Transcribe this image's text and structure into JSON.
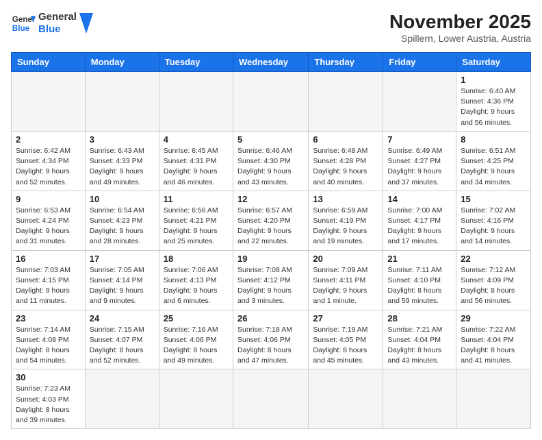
{
  "header": {
    "logo_general": "General",
    "logo_blue": "Blue",
    "month_title": "November 2025",
    "subtitle": "Spillern, Lower Austria, Austria"
  },
  "weekdays": [
    "Sunday",
    "Monday",
    "Tuesday",
    "Wednesday",
    "Thursday",
    "Friday",
    "Saturday"
  ],
  "weeks": [
    [
      {
        "day": "",
        "info": ""
      },
      {
        "day": "",
        "info": ""
      },
      {
        "day": "",
        "info": ""
      },
      {
        "day": "",
        "info": ""
      },
      {
        "day": "",
        "info": ""
      },
      {
        "day": "",
        "info": ""
      },
      {
        "day": "1",
        "info": "Sunrise: 6:40 AM\nSunset: 4:36 PM\nDaylight: 9 hours and 56 minutes."
      }
    ],
    [
      {
        "day": "2",
        "info": "Sunrise: 6:42 AM\nSunset: 4:34 PM\nDaylight: 9 hours and 52 minutes."
      },
      {
        "day": "3",
        "info": "Sunrise: 6:43 AM\nSunset: 4:33 PM\nDaylight: 9 hours and 49 minutes."
      },
      {
        "day": "4",
        "info": "Sunrise: 6:45 AM\nSunset: 4:31 PM\nDaylight: 9 hours and 46 minutes."
      },
      {
        "day": "5",
        "info": "Sunrise: 6:46 AM\nSunset: 4:30 PM\nDaylight: 9 hours and 43 minutes."
      },
      {
        "day": "6",
        "info": "Sunrise: 6:48 AM\nSunset: 4:28 PM\nDaylight: 9 hours and 40 minutes."
      },
      {
        "day": "7",
        "info": "Sunrise: 6:49 AM\nSunset: 4:27 PM\nDaylight: 9 hours and 37 minutes."
      },
      {
        "day": "8",
        "info": "Sunrise: 6:51 AM\nSunset: 4:25 PM\nDaylight: 9 hours and 34 minutes."
      }
    ],
    [
      {
        "day": "9",
        "info": "Sunrise: 6:53 AM\nSunset: 4:24 PM\nDaylight: 9 hours and 31 minutes."
      },
      {
        "day": "10",
        "info": "Sunrise: 6:54 AM\nSunset: 4:23 PM\nDaylight: 9 hours and 28 minutes."
      },
      {
        "day": "11",
        "info": "Sunrise: 6:56 AM\nSunset: 4:21 PM\nDaylight: 9 hours and 25 minutes."
      },
      {
        "day": "12",
        "info": "Sunrise: 6:57 AM\nSunset: 4:20 PM\nDaylight: 9 hours and 22 minutes."
      },
      {
        "day": "13",
        "info": "Sunrise: 6:59 AM\nSunset: 4:19 PM\nDaylight: 9 hours and 19 minutes."
      },
      {
        "day": "14",
        "info": "Sunrise: 7:00 AM\nSunset: 4:17 PM\nDaylight: 9 hours and 17 minutes."
      },
      {
        "day": "15",
        "info": "Sunrise: 7:02 AM\nSunset: 4:16 PM\nDaylight: 9 hours and 14 minutes."
      }
    ],
    [
      {
        "day": "16",
        "info": "Sunrise: 7:03 AM\nSunset: 4:15 PM\nDaylight: 9 hours and 11 minutes."
      },
      {
        "day": "17",
        "info": "Sunrise: 7:05 AM\nSunset: 4:14 PM\nDaylight: 9 hours and 9 minutes."
      },
      {
        "day": "18",
        "info": "Sunrise: 7:06 AM\nSunset: 4:13 PM\nDaylight: 9 hours and 6 minutes."
      },
      {
        "day": "19",
        "info": "Sunrise: 7:08 AM\nSunset: 4:12 PM\nDaylight: 9 hours and 3 minutes."
      },
      {
        "day": "20",
        "info": "Sunrise: 7:09 AM\nSunset: 4:11 PM\nDaylight: 9 hours and 1 minute."
      },
      {
        "day": "21",
        "info": "Sunrise: 7:11 AM\nSunset: 4:10 PM\nDaylight: 8 hours and 59 minutes."
      },
      {
        "day": "22",
        "info": "Sunrise: 7:12 AM\nSunset: 4:09 PM\nDaylight: 8 hours and 56 minutes."
      }
    ],
    [
      {
        "day": "23",
        "info": "Sunrise: 7:14 AM\nSunset: 4:08 PM\nDaylight: 8 hours and 54 minutes."
      },
      {
        "day": "24",
        "info": "Sunrise: 7:15 AM\nSunset: 4:07 PM\nDaylight: 8 hours and 52 minutes."
      },
      {
        "day": "25",
        "info": "Sunrise: 7:16 AM\nSunset: 4:06 PM\nDaylight: 8 hours and 49 minutes."
      },
      {
        "day": "26",
        "info": "Sunrise: 7:18 AM\nSunset: 4:06 PM\nDaylight: 8 hours and 47 minutes."
      },
      {
        "day": "27",
        "info": "Sunrise: 7:19 AM\nSunset: 4:05 PM\nDaylight: 8 hours and 45 minutes."
      },
      {
        "day": "28",
        "info": "Sunrise: 7:21 AM\nSunset: 4:04 PM\nDaylight: 8 hours and 43 minutes."
      },
      {
        "day": "29",
        "info": "Sunrise: 7:22 AM\nSunset: 4:04 PM\nDaylight: 8 hours and 41 minutes."
      }
    ],
    [
      {
        "day": "30",
        "info": "Sunrise: 7:23 AM\nSunset: 4:03 PM\nDaylight: 8 hours and 39 minutes."
      },
      {
        "day": "",
        "info": ""
      },
      {
        "day": "",
        "info": ""
      },
      {
        "day": "",
        "info": ""
      },
      {
        "day": "",
        "info": ""
      },
      {
        "day": "",
        "info": ""
      },
      {
        "day": "",
        "info": ""
      }
    ]
  ]
}
